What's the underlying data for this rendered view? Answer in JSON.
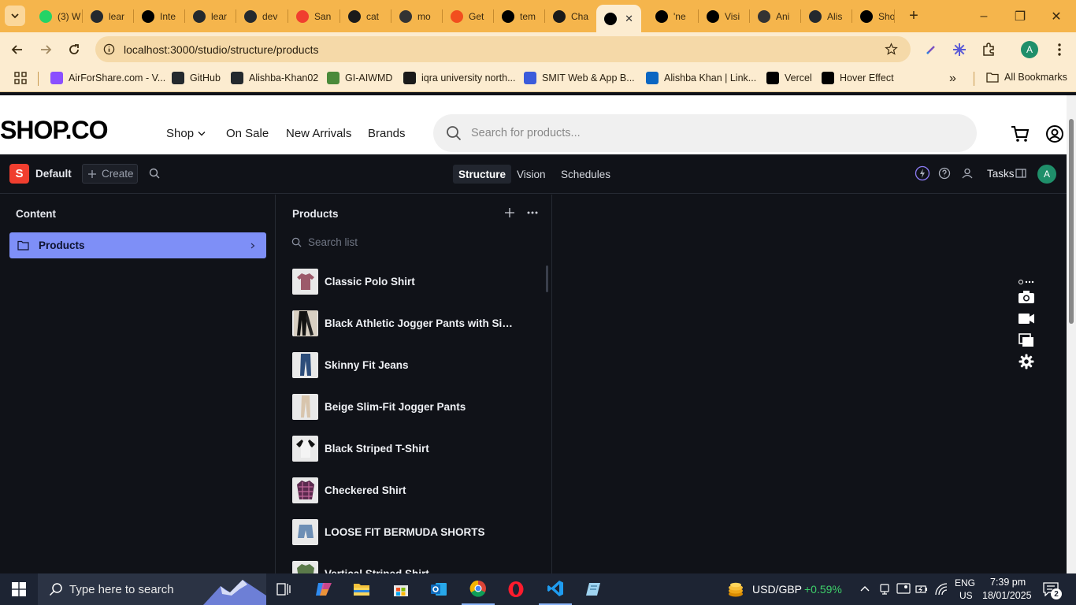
{
  "browser": {
    "tabs": [
      {
        "label": "(3) W",
        "icon": "whatsapp-icon",
        "color": "#25d366"
      },
      {
        "label": "lear",
        "icon": "github-icon",
        "color": "#24292e"
      },
      {
        "label": "Inte",
        "icon": "medium-icon",
        "color": "#000000"
      },
      {
        "label": "lear",
        "icon": "github-icon",
        "color": "#24292e"
      },
      {
        "label": "dev",
        "icon": "github-icon",
        "color": "#24292e"
      },
      {
        "label": "San",
        "icon": "sanity-icon",
        "color": "#f03e2f"
      },
      {
        "label": "cat",
        "icon": "openai-icon",
        "color": "#1a1a1a"
      },
      {
        "label": "mo",
        "icon": "api-icon",
        "color": "#333333"
      },
      {
        "label": "Get",
        "icon": "figma-icon",
        "color": "#f24e1e"
      },
      {
        "label": "tem",
        "icon": "vercel-icon",
        "color": "#000000"
      },
      {
        "label": "Cha",
        "icon": "openai-icon",
        "color": "#1a1a1a"
      },
      {
        "label": "",
        "icon": "vercel-icon",
        "color": "#000000",
        "active": true
      },
      {
        "label": "'ne",
        "icon": "nextjs-icon",
        "color": "#000000"
      },
      {
        "label": "Visi",
        "icon": "vercel-icon",
        "color": "#000000"
      },
      {
        "label": "Ani",
        "icon": "aceternity-icon",
        "color": "#333333"
      },
      {
        "label": "Alis",
        "icon": "github-icon",
        "color": "#24292e"
      },
      {
        "label": "Sho",
        "icon": "vercel-icon",
        "color": "#000000"
      }
    ],
    "url": "localhost:3000/studio/structure/products",
    "profile_initial": "A",
    "bookmarks": [
      {
        "label": "AirForShare.com - V...",
        "icon": "airforshare-icon",
        "color": "#8a4fff"
      },
      {
        "label": "GitHub",
        "icon": "github-icon",
        "color": "#24292e"
      },
      {
        "label": "Alishba-Khan02",
        "icon": "github-icon",
        "color": "#24292e"
      },
      {
        "label": "GI-AIWMD",
        "icon": "gi-icon",
        "color": "#4a8a3a"
      },
      {
        "label": "iqra university north...",
        "icon": "globe-icon",
        "color": "#1a1a1a"
      },
      {
        "label": "SMIT Web & App B...",
        "icon": "contact-card-icon",
        "color": "#3b5bdb"
      },
      {
        "label": "Alishba Khan | Link...",
        "icon": "linkedin-icon",
        "color": "#0a66c2"
      },
      {
        "label": "Vercel",
        "icon": "vercel-icon",
        "color": "#000000"
      },
      {
        "label": "Hover Effect",
        "icon": "hover-icon",
        "color": "#000000"
      }
    ],
    "all_bookmarks": "All Bookmarks"
  },
  "shop": {
    "logo": "SHOP.CO",
    "nav": [
      "Shop",
      "On Sale",
      "New Arrivals",
      "Brands"
    ],
    "search_placeholder": "Search for products..."
  },
  "studio": {
    "workspace": "Default",
    "create_label": "Create",
    "tabs": [
      "Structure",
      "Vision",
      "Schedules"
    ],
    "active_tab": "Structure",
    "tasks_label": "Tasks",
    "user_initial": "A",
    "content_title": "Content",
    "content_items": [
      "Products"
    ],
    "list_title": "Products",
    "list_search_placeholder": "Search list",
    "documents": [
      {
        "title": "Classic Polo Shirt",
        "thumb": "polo-shirt"
      },
      {
        "title": "Black Athletic Jogger Pants with Side S...",
        "thumb": "black-joggers"
      },
      {
        "title": "Skinny Fit Jeans",
        "thumb": "jeans"
      },
      {
        "title": "Beige Slim-Fit Jogger Pants",
        "thumb": "beige-joggers"
      },
      {
        "title": "Black Striped T-Shirt",
        "thumb": "raglan-tee"
      },
      {
        "title": "Checkered Shirt",
        "thumb": "plaid-shirt"
      },
      {
        "title": "LOOSE FIT BERMUDA SHORTS",
        "thumb": "denim-shorts"
      },
      {
        "title": "Vertical Striped Shirt",
        "thumb": "green-shirt"
      }
    ]
  },
  "taskbar": {
    "search_placeholder": "Type here to search",
    "currency": "USD/GBP",
    "currency_change": "+0.59%",
    "lang_top": "ENG",
    "lang_bottom": "US",
    "time": "7:39 pm",
    "date": "18/01/2025",
    "notifications": "2"
  }
}
